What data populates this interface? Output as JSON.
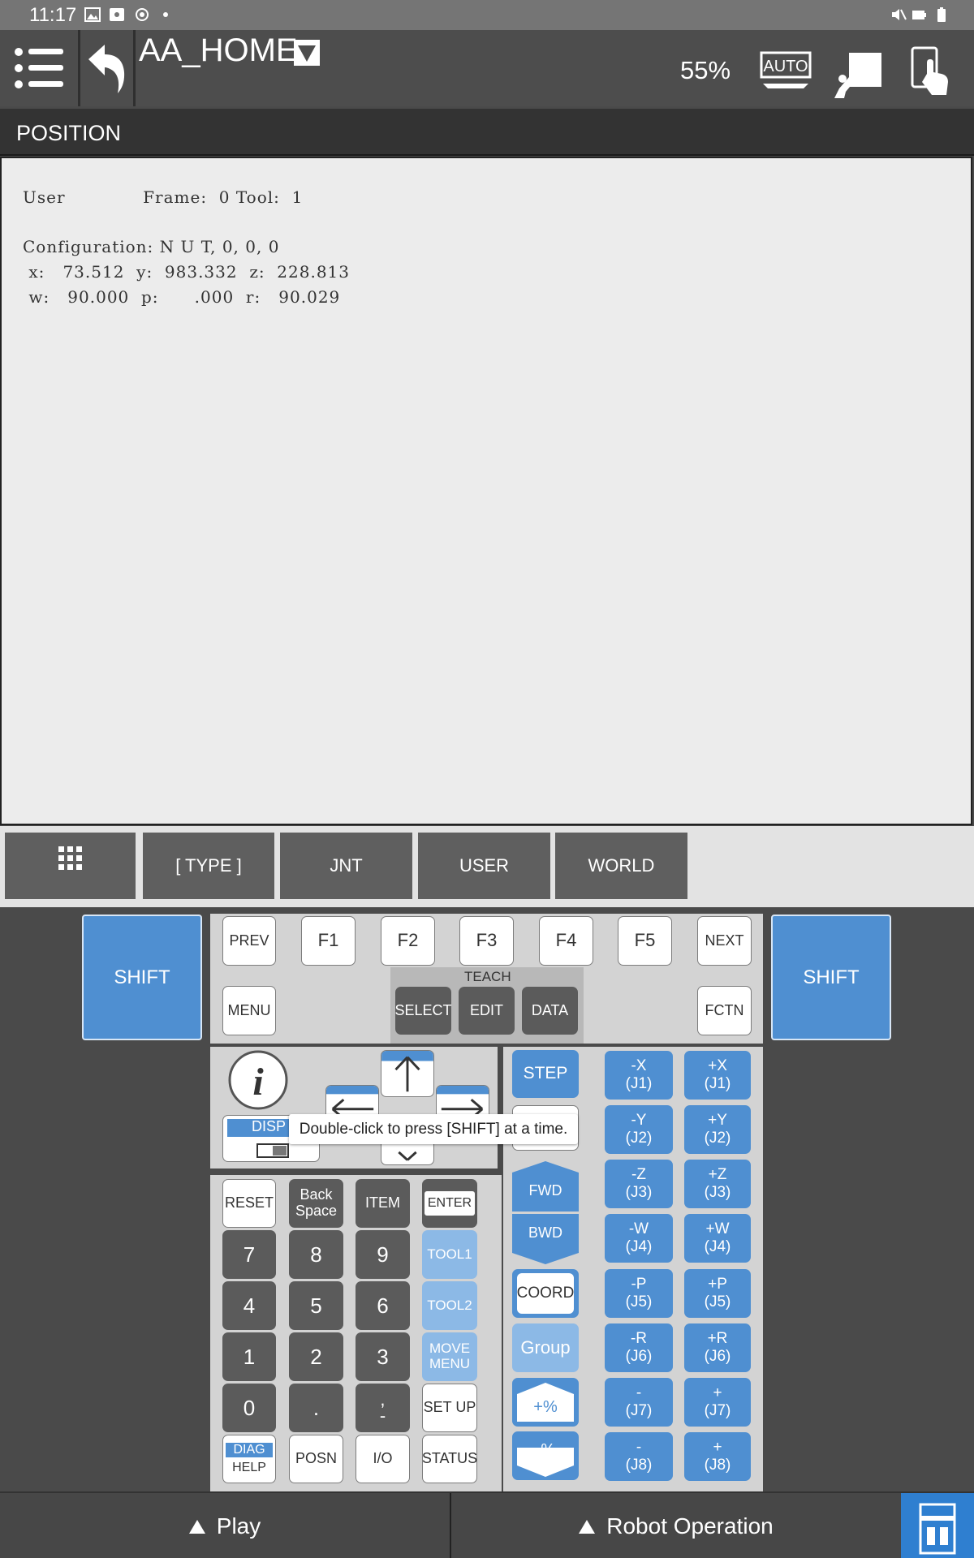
{
  "status_bar": {
    "time": "11:17"
  },
  "header": {
    "program_name": "AA_HOME",
    "speed": "55%",
    "auto_label": "AUTO"
  },
  "position": {
    "title": "POSITION",
    "line1": "User             Frame:  0 Tool:  1",
    "line2": "Configuration: N U T, 0, 0, 0",
    "line3": " x:   73.512  y:  983.332  z:  228.813",
    "line4": " w:   90.000  p:      .000  r:   90.029"
  },
  "function_keys": [
    "[ TYPE ]",
    "JNT",
    "USER",
    "WORLD"
  ],
  "keypad": {
    "shift": "SHIFT",
    "prev": "PREV",
    "next": "NEXT",
    "f_keys": [
      "F1",
      "F2",
      "F3",
      "F4",
      "F5"
    ],
    "menu": "MENU",
    "fctn": "FCTN",
    "teach": "TEACH",
    "select": "SELECT",
    "edit": "EDIT",
    "data": "DATA",
    "disp": "DISP",
    "tooltip": "Double-click to press [SHIFT] at a time.",
    "reset": "RESET",
    "backspace": "Back\nSpace",
    "item": "ITEM",
    "enter": "ENTER",
    "digits": [
      "7",
      "8",
      "9",
      "4",
      "5",
      "6",
      "1",
      "2",
      "3",
      "0",
      "."
    ],
    "comma_minus": ",\n-",
    "tool1": "TOOL1",
    "tool2": "TOOL2",
    "move_menu": "MOVE\nMENU",
    "setup": "SET UP",
    "diag": "DIAG",
    "help": "HELP",
    "posn": "POSN",
    "io": "I/O",
    "status": "STATUS",
    "step": "STEP",
    "fwd": "FWD",
    "bwd": "BWD",
    "coord": "COORD",
    "group": "Group",
    "plus_pct": "+%",
    "minus_pct": "-%",
    "jog_minus": [
      "-X\n(J1)",
      "-Y\n(J2)",
      "-Z\n(J3)",
      "-W\n(J4)",
      "-P\n(J5)",
      "-R\n(J6)",
      "-\n(J7)",
      "-\n(J8)"
    ],
    "jog_plus": [
      "+X\n(J1)",
      "+Y\n(J2)",
      "+Z\n(J3)",
      "+W\n(J4)",
      "+P\n(J5)",
      "+R\n(J6)",
      "+\n(J7)",
      "+\n(J8)"
    ]
  },
  "bottom_bar": {
    "play": "Play",
    "robot_operation": "Robot Operation"
  }
}
